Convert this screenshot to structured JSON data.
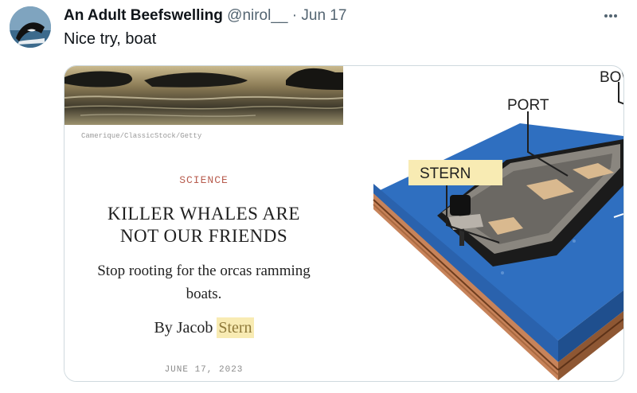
{
  "tweet": {
    "author_name": "An Adult Beefswelling",
    "author_handle": "@nirol__",
    "separator": "·",
    "date": "Jun 17",
    "text": "Nice try, boat"
  },
  "article": {
    "photo_credit": "Camerique/ClassicStock/Getty",
    "section": "SCIENCE",
    "headline_line1": "KILLER WHALES ARE",
    "headline_line2": "NOT OUR FRIENDS",
    "dek_line1": "Stop rooting for the orcas ramming",
    "dek_line2": "boats.",
    "byline_prefix": "By Jacob ",
    "byline_author": "Stern",
    "date": "JUNE 17, 2023"
  },
  "diagram": {
    "labels": {
      "bow": "BOW",
      "port": "PORT",
      "stern": "STERN"
    }
  },
  "colors": {
    "highlight": "#f8ebb3",
    "water": "#2f6fc0",
    "section_label": "#b85d4f",
    "handle_gray": "#536471"
  },
  "icons": {
    "more": "more-horizontal-icon"
  }
}
